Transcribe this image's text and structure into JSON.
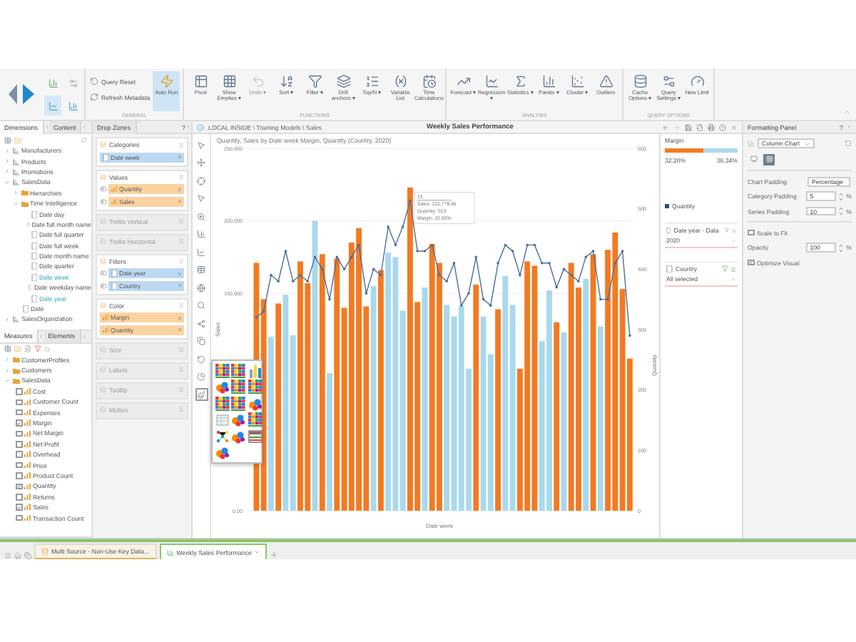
{
  "ribbon": {
    "groups": [
      {
        "label": "GENERAL",
        "items": [
          {
            "label": "Query Reset",
            "kind": "small",
            "active": false,
            "disabled": false
          },
          {
            "label": "Refresh Metadata",
            "kind": "small",
            "active": false,
            "disabled": false
          },
          {
            "label": "Auto Run",
            "kind": "big",
            "active": true,
            "disabled": false
          }
        ]
      },
      {
        "label": "FUNCTIONS",
        "items": [
          {
            "label": "Pivot",
            "kind": "big",
            "active": false,
            "disabled": false
          },
          {
            "label": "Show Empties ▾",
            "kind": "big",
            "active": false,
            "disabled": false
          },
          {
            "label": "Undo ▾",
            "kind": "big",
            "active": false,
            "disabled": true
          },
          {
            "label": "Sort ▾",
            "kind": "big",
            "active": false,
            "disabled": false
          },
          {
            "label": "Filter ▾",
            "kind": "big",
            "active": false,
            "disabled": false
          },
          {
            "label": "Drill anchors ▾",
            "kind": "big",
            "active": false,
            "disabled": false
          },
          {
            "label": "Top/N ▾",
            "kind": "big",
            "active": false,
            "disabled": false
          },
          {
            "label": "Variable List",
            "kind": "big",
            "active": false,
            "disabled": false
          },
          {
            "label": "Time Calculations",
            "kind": "big",
            "active": false,
            "disabled": false
          }
        ]
      },
      {
        "label": "ANALYSIS",
        "items": [
          {
            "label": "Forecast ▾",
            "kind": "big",
            "active": false,
            "disabled": false
          },
          {
            "label": "Regression ▾",
            "kind": "big",
            "active": false,
            "disabled": false
          },
          {
            "label": "Statistics ▾",
            "kind": "big",
            "active": false,
            "disabled": false
          },
          {
            "label": "Pareto ▾",
            "kind": "big",
            "active": false,
            "disabled": false
          },
          {
            "label": "Cluster ▾",
            "kind": "big",
            "active": false,
            "disabled": false
          },
          {
            "label": "Outliers",
            "kind": "big",
            "active": false,
            "disabled": false
          }
        ]
      },
      {
        "label": "QUERY OPTIONS",
        "items": [
          {
            "label": "Cache Options ▾",
            "kind": "big",
            "active": false,
            "disabled": false
          },
          {
            "label": "Query Settings ▾",
            "kind": "big",
            "active": false,
            "disabled": false
          },
          {
            "label": "New Limit",
            "kind": "big",
            "active": false,
            "disabled": false
          }
        ]
      }
    ]
  },
  "dimensions_panel": {
    "tabs": [
      {
        "label": "Dimensions",
        "selected": true
      },
      {
        "label": "Content",
        "selected": false
      }
    ],
    "tree": [
      {
        "label": "Manufacturers",
        "kind": "dimension",
        "expanded": false
      },
      {
        "label": "Products",
        "kind": "dimension",
        "expanded": false
      },
      {
        "label": "Promotions",
        "kind": "dimension",
        "expanded": false
      },
      {
        "label": "SalesData",
        "kind": "dimension",
        "expanded": true,
        "children": [
          {
            "label": "Hierarchies",
            "kind": "folder",
            "expanded": false
          },
          {
            "label": "Time Intelligence",
            "kind": "folder",
            "expanded": true,
            "children": [
              {
                "label": "Date day",
                "kind": "attribute",
                "in_use": false
              },
              {
                "label": "Date full month name",
                "kind": "attribute",
                "in_use": false
              },
              {
                "label": "Date full quarter",
                "kind": "attribute",
                "in_use": false
              },
              {
                "label": "Date full week",
                "kind": "attribute",
                "in_use": false
              },
              {
                "label": "Date month name",
                "kind": "attribute",
                "in_use": false
              },
              {
                "label": "Date quarter",
                "kind": "attribute",
                "in_use": false
              },
              {
                "label": "Date week",
                "kind": "attribute",
                "in_use": true
              },
              {
                "label": "Date weekday name",
                "kind": "attribute",
                "in_use": false
              },
              {
                "label": "Date year",
                "kind": "attribute",
                "in_use": true
              }
            ]
          },
          {
            "label": "Date",
            "kind": "attribute",
            "in_use": false
          }
        ]
      },
      {
        "label": "SalesOrganization",
        "kind": "dimension",
        "expanded": false
      }
    ]
  },
  "measures_panel": {
    "tabs": [
      {
        "label": "Measures",
        "selected": true
      },
      {
        "label": "Elements",
        "selected": false
      }
    ],
    "folders": [
      {
        "label": "CustomerProfiles",
        "expanded": false
      },
      {
        "label": "Customers",
        "expanded": false
      },
      {
        "label": "SalesData",
        "expanded": true
      }
    ],
    "measures": [
      {
        "label": "Cost",
        "checked": false
      },
      {
        "label": "Customer Count",
        "checked": false
      },
      {
        "label": "Expenses",
        "checked": false
      },
      {
        "label": "Margin",
        "checked": true
      },
      {
        "label": "Net Margin",
        "checked": false
      },
      {
        "label": "Net Profit",
        "checked": false
      },
      {
        "label": "Overhead",
        "checked": false
      },
      {
        "label": "Price",
        "checked": false
      },
      {
        "label": "Product Count",
        "checked": false
      },
      {
        "label": "Quantity",
        "checked": true
      },
      {
        "label": "Returns",
        "checked": false
      },
      {
        "label": "Sales",
        "checked": true
      },
      {
        "label": "Transaction Count",
        "checked": false
      }
    ]
  },
  "drop_zones": {
    "title": "Drop Zones",
    "help": "?",
    "zones": [
      {
        "label": "Categories",
        "chips": [
          {
            "label": "Date week",
            "kind": "dimension",
            "toggle": false
          }
        ]
      },
      {
        "label": "Values",
        "chips": [
          {
            "label": "Quantity",
            "kind": "measure",
            "toggle": true
          },
          {
            "label": "Sales",
            "kind": "measure",
            "toggle": true
          }
        ]
      },
      {
        "label": "Trellis Vertical"
      },
      {
        "label": "Trellis Horizontal"
      },
      {
        "label": "Filters",
        "chips": [
          {
            "label": "Date year",
            "kind": "dimension",
            "toggle": true
          },
          {
            "label": "Country",
            "kind": "dimension",
            "toggle": true
          }
        ]
      },
      {
        "label": "Color",
        "chips": [
          {
            "label": "Margin",
            "kind": "measure",
            "toggle": false
          },
          {
            "label": "Quantity",
            "kind": "measure",
            "toggle": false
          }
        ]
      },
      {
        "label": "Size"
      },
      {
        "label": "Labels"
      },
      {
        "label": "Tooltip"
      },
      {
        "label": "Motion"
      }
    ]
  },
  "report": {
    "breadcrumb": "LOCAL INSIDE \\ Training Models \\ Sales",
    "title": "Weekly Sales Performance",
    "chart_title": "Quantity, Sales by Date week Margin, Quantity (Country, 2020)",
    "chart_data": {
      "type": "bar",
      "xlabel": "Date week",
      "ylabel": "Sales",
      "y2label": "Quantity",
      "ylim": [
        0,
        250000
      ],
      "yticks": [
        {
          "value": 0,
          "label": "0.00"
        },
        {
          "value": 150000,
          "label": "150,000"
        },
        {
          "value": 200000,
          "label": "200,000"
        },
        {
          "value": 250000,
          "label": "250,000"
        }
      ],
      "y2lim": [
        0,
        600
      ],
      "y2ticks": [
        0,
        100,
        200,
        300,
        400,
        500,
        600
      ],
      "series": [
        {
          "type": "bar",
          "values": [
            null,
            171000,
            146000,
            120000,
            143000,
            149000,
            121000,
            172000,
            157000,
            200000,
            177000,
            95000,
            174000,
            140000,
            185000,
            195000,
            141000,
            155000,
            166000,
            178000,
            175000,
            138000,
            223000,
            144000,
            154000,
            184000,
            171000,
            142000,
            134000,
            141000,
            98000,
            156000,
            134000,
            108000,
            139000,
            162000,
            142000,
            98000,
            172000,
            169000,
            117000,
            152000,
            130000,
            123000,
            171000,
            154000,
            160000,
            177000,
            127000,
            180000,
            192000,
            153000,
            105000
          ],
          "colors": [
            null,
            "#f37a21",
            "#f37a21",
            "#a9d9ec",
            "#f37a21",
            "#a9d9ec",
            "#a9d9ec",
            "#f37a21",
            "#f37a21",
            "#a9d9ec",
            "#f37a21",
            "#a9d9ec",
            "#f37a21",
            "#f37a21",
            "#f37a21",
            "#f37a21",
            "#f37a21",
            "#a9d9ec",
            "#f37a21",
            "#a9d9ec",
            "#a9d9ec",
            "#a9d9ec",
            "#f37a21",
            "#f37a21",
            "#a9d9ec",
            "#f37a21",
            "#f37a21",
            "#a9d9ec",
            "#a9d9ec",
            "#a9d9ec",
            "#a9d9ec",
            "#f37a21",
            "#a9d9ec",
            "#a9d9ec",
            "#f37a21",
            "#a9d9ec",
            "#a9d9ec",
            "#f37a21",
            "#f37a21",
            "#f37a21",
            "#a9d9ec",
            "#a9d9ec",
            "#f37a21",
            "#a9d9ec",
            "#f37a21",
            "#f37a21",
            "#a9d9ec",
            "#f37a21",
            "#a9d9ec",
            "#f37a21",
            "#f37a21",
            "#f37a21",
            "#f37a21"
          ]
        },
        {
          "type": "line",
          "axis": "y2",
          "color": "#4b6e9b",
          "values": [
            null,
            320,
            330,
            390,
            380,
            430,
            380,
            390,
            380,
            420,
            400,
            350,
            420,
            400,
            420,
            440,
            360,
            400,
            390,
            470,
            440,
            470,
            513,
            430,
            430,
            440,
            390,
            380,
            410,
            340,
            360,
            420,
            350,
            340,
            410,
            440,
            430,
            390,
            440,
            440,
            410,
            410,
            370,
            400,
            390,
            380,
            420,
            430,
            350,
            350,
            410,
            430,
            290
          ]
        }
      ]
    },
    "tooltip": [
      "23",
      "Sales: 222,778.96",
      "Quantity: 513",
      "Margin: 32.95%"
    ],
    "visual_picker": [
      {
        "kind": "heatmap"
      },
      {
        "kind": "heatmap"
      },
      {
        "kind": "bars"
      },
      {
        "kind": "bubbles"
      },
      {
        "kind": "heatmap"
      },
      {
        "kind": "heatmap"
      },
      {
        "kind": "heatmap"
      },
      {
        "kind": "heatmap"
      },
      {
        "kind": "bubbles"
      },
      {
        "kind": "sheet"
      },
      {
        "kind": "bubbles"
      },
      {
        "kind": "heatmap"
      },
      {
        "kind": "network"
      },
      {
        "kind": "bubbles"
      },
      {
        "kind": "table"
      },
      {
        "kind": "bubbles"
      }
    ]
  },
  "legend": {
    "color_title": "Margin",
    "color_min": "32.20%",
    "color_max": "36.34%",
    "level": 0.52,
    "series": [
      {
        "label": "Quantity",
        "color": "#2d4d73"
      }
    ],
    "filters": [
      {
        "label": "Date year - Data",
        "value": "2020"
      },
      {
        "label": "Country",
        "value": "All selected"
      }
    ]
  },
  "formatting_panel": {
    "title": "Formatting Panel",
    "help": "?",
    "chart_type": "Column Chart",
    "fields": [
      {
        "label": "Chart Padding",
        "kind": "select",
        "value": "Percentage"
      },
      {
        "label": "Category Padding",
        "kind": "number",
        "value": "5",
        "unit": "%"
      },
      {
        "label": "Series Padding",
        "kind": "number",
        "value": "10",
        "unit": "%"
      },
      {
        "kind": "divider"
      },
      {
        "label": "Scale to Fit",
        "kind": "checkbox",
        "checked": false
      },
      {
        "label": "Opacity",
        "kind": "number",
        "value": "100",
        "unit": "%"
      },
      {
        "label": "Optimize Visual",
        "kind": "checkbox",
        "checked": true
      }
    ]
  },
  "doc_tabs": [
    {
      "label": "Multi Source - Non-Use Key Data...",
      "selected": false
    },
    {
      "label": "Weekly Sales Performance",
      "selected": true
    }
  ]
}
